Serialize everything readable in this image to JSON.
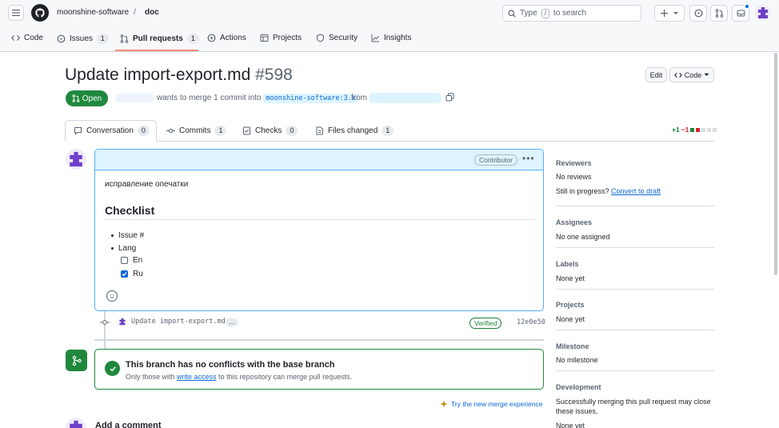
{
  "header": {
    "owner": "moonshine-software",
    "separator": "/",
    "repo": "doc",
    "search_placeholder": "Type",
    "search_key": "/",
    "search_suffix": "to search"
  },
  "nav": {
    "code": "Code",
    "issues": "Issues",
    "issues_count": "1",
    "pull_requests": "Pull requests",
    "pull_requests_count": "1",
    "actions": "Actions",
    "projects": "Projects",
    "security": "Security",
    "insights": "Insights"
  },
  "pr": {
    "title": "Update import-export.md",
    "number": "#598",
    "edit_label": "Edit",
    "code_label": "Code",
    "state": "Open",
    "merge_text": "wants to merge 1 commit into",
    "base_branch": "moonshine-software:3.x",
    "from_text": "from"
  },
  "tabs": {
    "conversation": "Conversation",
    "conversation_count": "0",
    "commits": "Commits",
    "commits_count": "1",
    "checks": "Checks",
    "checks_count": "0",
    "files_changed": "Files changed",
    "files_changed_count": "1",
    "additions": "+1",
    "deletions": "−1"
  },
  "comment": {
    "badge": "Contributor",
    "text": "исправление опечатки",
    "heading": "Checklist",
    "items": [
      "Issue #",
      "Lang"
    ],
    "subitems": [
      {
        "label": "En",
        "checked": false
      },
      {
        "label": "Ru",
        "checked": true
      }
    ]
  },
  "commit": {
    "message": "Update import-export.md",
    "ellipsis": "…",
    "verified": "Verified",
    "sha": "12e0e50"
  },
  "merge": {
    "title": "This branch has no conflicts with the base branch",
    "sub_before": "Only those with",
    "sub_link": "write access",
    "sub_after": "to this repository can merge pull requests.",
    "try_new": "Try the new merge experience"
  },
  "add_comment": "Add a comment",
  "sidebar": {
    "reviewers_h": "Reviewers",
    "reviewers_v": "No reviews",
    "progress_text": "Still in progress?",
    "progress_link": "Convert to draft",
    "assignees_h": "Assignees",
    "assignees_v": "No one assigned",
    "labels_h": "Labels",
    "labels_v": "None yet",
    "projects_h": "Projects",
    "projects_v": "None yet",
    "milestone_h": "Milestone",
    "milestone_v": "No milestone",
    "development_h": "Development",
    "development_v1": "Successfully merging this pull request may close",
    "development_v2": "these issues.",
    "development_v3": "None yet"
  },
  "colors": {
    "open_green": "#1f883d",
    "accent_blue": "#0969da",
    "avatar_purple": "#6e40c9",
    "tab_underline": "#fd8c73"
  }
}
